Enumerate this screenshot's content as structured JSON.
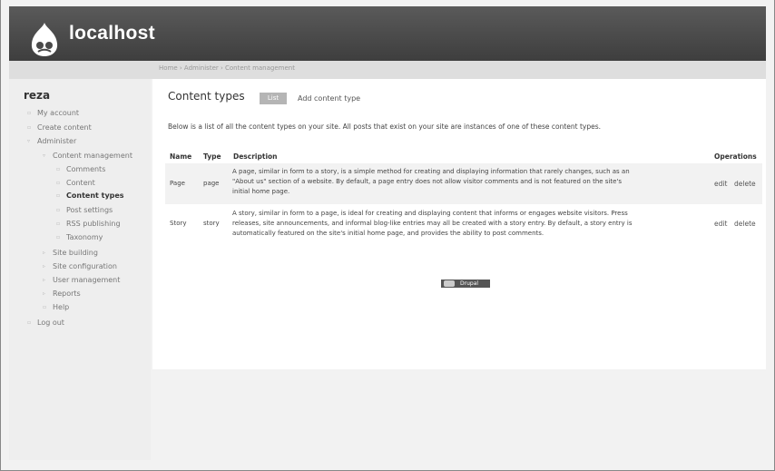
{
  "site": {
    "name": "localhost"
  },
  "breadcrumb": "Home › Administer › Content management",
  "sidebar": {
    "user": "reza",
    "items": [
      {
        "label": "My account"
      },
      {
        "label": "Create content"
      },
      {
        "label": "Administer"
      },
      {
        "label": "Content management"
      },
      {
        "label": "Comments"
      },
      {
        "label": "Content"
      },
      {
        "label": "Content types"
      },
      {
        "label": "Post settings"
      },
      {
        "label": "RSS publishing"
      },
      {
        "label": "Taxonomy"
      },
      {
        "label": "Site building"
      },
      {
        "label": "Site configuration"
      },
      {
        "label": "User management"
      },
      {
        "label": "Reports"
      },
      {
        "label": "Help"
      },
      {
        "label": "Log out"
      }
    ]
  },
  "main": {
    "title": "Content types",
    "tabs": [
      {
        "label": "List"
      },
      {
        "label": "Add content type"
      }
    ],
    "intro": "Below is a list of all the content types on your site. All posts that exist on your site are instances of one of these content types.",
    "table": {
      "headers": [
        "Name",
        "Type",
        "Description",
        "Operations"
      ],
      "rows": [
        {
          "name": "Page",
          "type": "page",
          "description": [
            "A page, similar in form to a story, is a simple method for creating and displaying information that rarely changes, such as an",
            "\"About us\" section of a website. By default, a page entry does not allow visitor comments and is not featured on the site's",
            "initial home page."
          ],
          "edit": "edit",
          "delete": "delete"
        },
        {
          "name": "Story",
          "type": "story",
          "description": [
            "A story, similar in form to a page, is ideal for creating and displaying content that informs or engages website visitors. Press",
            "releases, site announcements, and informal blog-like entries may all be created with a story entry. By default, a story entry is",
            "automatically featured on the site's initial home page, and provides the ability to post comments."
          ],
          "edit": "edit",
          "delete": "delete"
        }
      ]
    }
  },
  "footer": {
    "badge": "Drupal"
  }
}
